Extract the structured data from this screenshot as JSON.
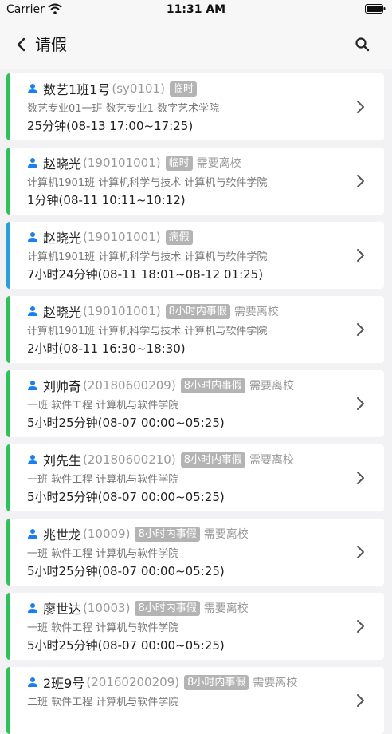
{
  "status_bar": {
    "carrier": "Carrier",
    "time": "11:31 AM"
  },
  "header": {
    "title": "请假"
  },
  "leaves": [
    {
      "name": "数艺1班1号",
      "id": "(sy0101)",
      "tag": "临时",
      "extra": "",
      "detail": "数艺专业01一班 数艺专业1 数字艺术学院",
      "duration": "25分钟(08-13 17:00~17:25)",
      "accent": "#2fc25b"
    },
    {
      "name": "赵晓光",
      "id": "(190101001)",
      "tag": "临时",
      "extra": "需要离校",
      "detail": "计算机1901班 计算机科学与技术 计算机与软件学院",
      "duration": "1分钟(08-11 10:11~10:12)",
      "accent": "#2fc25b"
    },
    {
      "name": "赵晓光",
      "id": "(190101001)",
      "tag": "病假",
      "extra": "",
      "detail": "计算机1901班 计算机科学与技术 计算机与软件学院",
      "duration": "7小时24分钟(08-11 18:01~08-12 01:25)",
      "accent": "#2b9fd8"
    },
    {
      "name": "赵晓光",
      "id": "(190101001)",
      "tag": "8小时内事假",
      "extra": "需要离校",
      "detail": "计算机1901班 计算机科学与技术 计算机与软件学院",
      "duration": "2小时(08-11 16:30~18:30)",
      "accent": "#2fc25b"
    },
    {
      "name": "刘帅奇",
      "id": "(20180600209)",
      "tag": "8小时内事假",
      "extra": "需要离校",
      "detail": "一班 软件工程 计算机与软件学院",
      "duration": "5小时25分钟(08-07 00:00~05:25)",
      "accent": "#2fc25b"
    },
    {
      "name": "刘先生",
      "id": "(20180600210)",
      "tag": "8小时内事假",
      "extra": "需要离校",
      "detail": "一班 软件工程 计算机与软件学院",
      "duration": "5小时25分钟(08-07 00:00~05:25)",
      "accent": "#2fc25b"
    },
    {
      "name": "兆世龙",
      "id": "(10009)",
      "tag": "8小时内事假",
      "extra": "需要离校",
      "detail": "一班 软件工程 计算机与软件学院",
      "duration": "5小时25分钟(08-07 00:00~05:25)",
      "accent": "#2fc25b"
    },
    {
      "name": "廖世达",
      "id": "(10003)",
      "tag": "8小时内事假",
      "extra": "需要离校",
      "detail": "一班 软件工程 计算机与软件学院",
      "duration": "5小时25分钟(08-07 00:00~05:25)",
      "accent": "#2fc25b"
    },
    {
      "name": "2班9号",
      "id": "(20160200209)",
      "tag": "8小时内事假",
      "extra": "需要离校",
      "detail": "二班 软件工程 计算机与软件学院",
      "duration": "",
      "accent": "#2fc25b"
    }
  ]
}
